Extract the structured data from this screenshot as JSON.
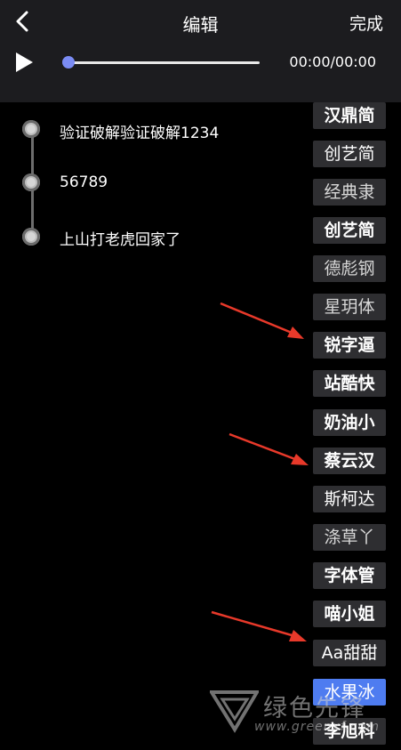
{
  "header": {
    "title": "编辑",
    "done_label": "完成"
  },
  "player": {
    "time": "00:00/00:00",
    "progress": 0
  },
  "lyrics": [
    {
      "text": "验证破解验证破解1234"
    },
    {
      "text": "56789"
    },
    {
      "text": "上山打老虎回家了"
    }
  ],
  "fonts": [
    {
      "label": "汉鼎简",
      "selected": false
    },
    {
      "label": "创艺简",
      "selected": false
    },
    {
      "label": "经典隶",
      "selected": false
    },
    {
      "label": "创艺简",
      "selected": false
    },
    {
      "label": "德彪钢",
      "selected": false
    },
    {
      "label": "星玥体",
      "selected": false
    },
    {
      "label": "锐字逼",
      "selected": false
    },
    {
      "label": "站酷快",
      "selected": false
    },
    {
      "label": "奶油小",
      "selected": false
    },
    {
      "label": "蔡云汉",
      "selected": false
    },
    {
      "label": "斯柯达",
      "selected": false
    },
    {
      "label": "涤草丫",
      "selected": false
    },
    {
      "label": "字体管",
      "selected": false
    },
    {
      "label": "喵小姐",
      "selected": false
    },
    {
      "label": "Aa甜甜",
      "selected": false
    },
    {
      "label": "水果冰",
      "selected": true
    },
    {
      "label": "李旭科",
      "selected": false
    }
  ],
  "colors": {
    "accent": "#4e7cf0",
    "thumb": "#7b8cf4",
    "arrow": "#e8392a"
  },
  "watermark": {
    "text": "绿色先锋",
    "url": "www.greenxf.com"
  }
}
